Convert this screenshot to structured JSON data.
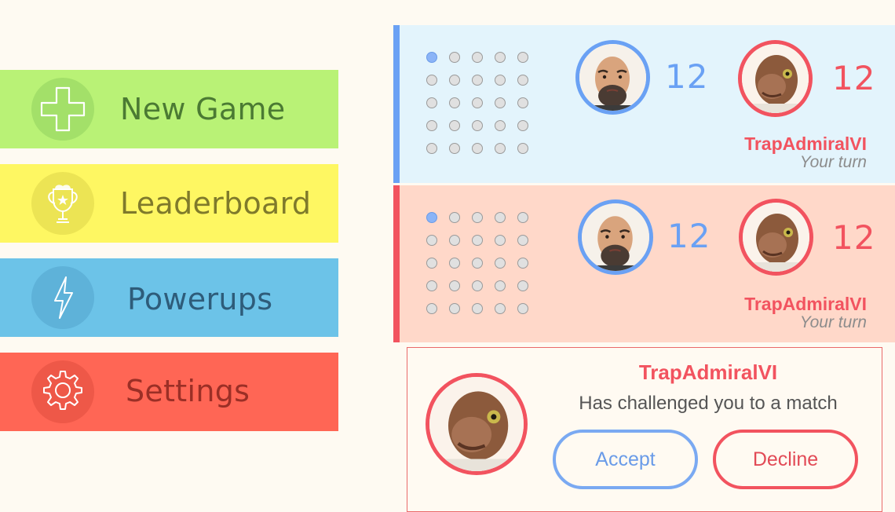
{
  "menu": {
    "new_game": {
      "label": "New Game",
      "icon": "plus-icon"
    },
    "leaderboard": {
      "label": "Leaderboard",
      "icon": "trophy-icon"
    },
    "powerups": {
      "label": "Powerups",
      "icon": "lightning-icon"
    },
    "settings": {
      "label": "Settings",
      "icon": "gear-icon"
    }
  },
  "matches": [
    {
      "player_score": "12",
      "opponent_score": "12",
      "opponent_name": "TrapAdmiralVI",
      "status": "Your turn",
      "accent": "#6aa1f4"
    },
    {
      "player_score": "12",
      "opponent_score": "12",
      "opponent_name": "TrapAdmiralVI",
      "status": "Your turn",
      "accent": "#f2535f"
    }
  ],
  "challenge": {
    "name": "TrapAdmiralVI",
    "message": "Has challenged you to a match",
    "accept_label": "Accept",
    "decline_label": "Decline"
  },
  "colors": {
    "blue": "#6aa1f4",
    "red": "#f2535f",
    "green": "#b9f276",
    "yellow": "#fef762",
    "sky": "#6cc3e8",
    "coral": "#ff6655"
  }
}
